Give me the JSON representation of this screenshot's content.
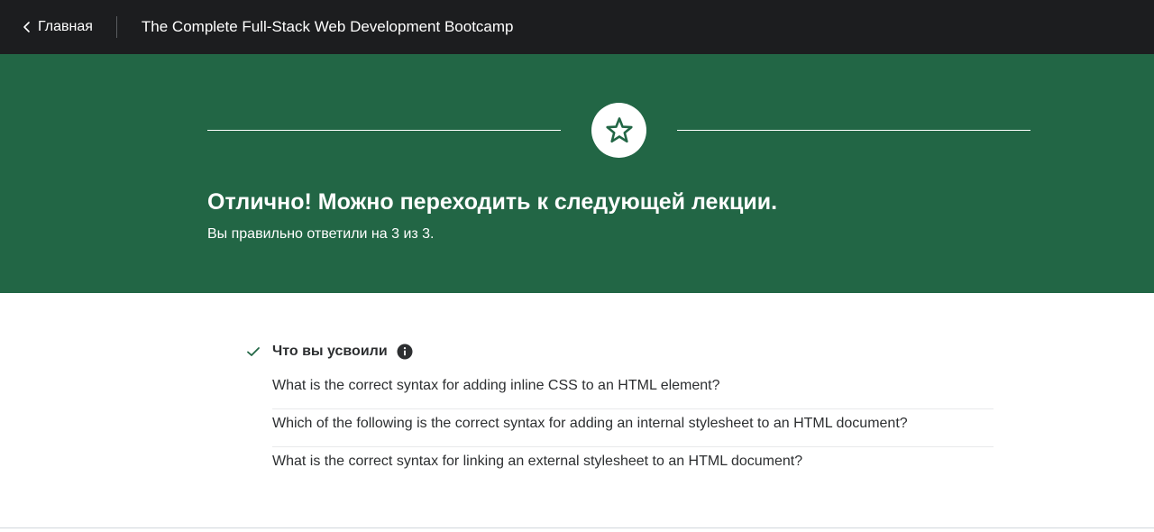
{
  "header": {
    "back_label": "Главная",
    "course_title": "The Complete Full-Stack Web Development Bootcamp"
  },
  "hero": {
    "title": "Отлично! Можно переходить к следующей лекции.",
    "subtitle": "Вы правильно ответили на 3 из 3.",
    "background_color": "#226645",
    "icon": "star-icon"
  },
  "learned": {
    "title": "Что вы усвоили",
    "questions": [
      "What is the correct syntax for adding inline CSS to an HTML element?",
      "Which of the following is the correct syntax for adding an internal stylesheet to an HTML document?",
      "What is the correct syntax for linking an external stylesheet to an HTML document?"
    ]
  }
}
